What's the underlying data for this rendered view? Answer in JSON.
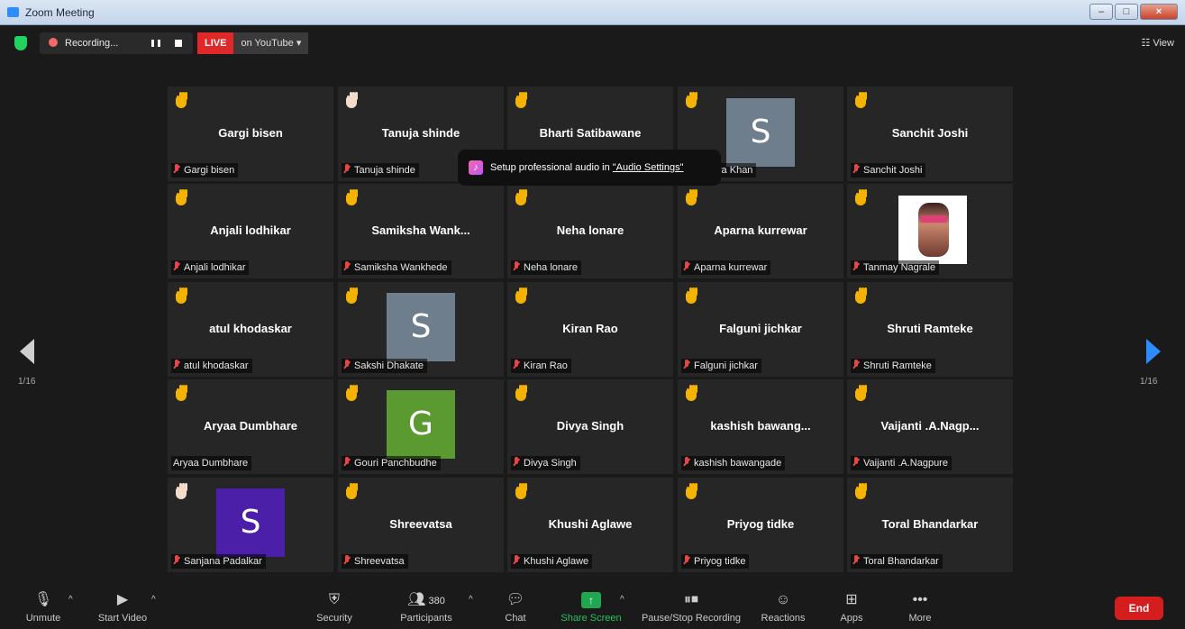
{
  "window": {
    "title": "Zoom Meeting",
    "controls": [
      "–",
      "□",
      "×"
    ]
  },
  "topbar": {
    "recording_label": "Recording...",
    "live_label": "LIVE",
    "youtube_label": "on YouTube ▾",
    "view_label": "☷ View"
  },
  "toast": {
    "text": "Setup professional audio in ",
    "link": "\"Audio Settings\"",
    "icon": "♪"
  },
  "pagination": {
    "left": "1/16",
    "right": "1/16"
  },
  "participants": [
    {
      "big": "Gargi bisen",
      "footer": "Gargi bisen",
      "hand": "yellow",
      "muted": true
    },
    {
      "big": "Tanuja shinde",
      "footer": "Tanuja shinde",
      "hand": "light",
      "muted": true
    },
    {
      "big": "Bharti Satibawane",
      "footer": "Bharti Satibawane",
      "hand": "yellow",
      "muted": true
    },
    {
      "big": "",
      "footer": "Somiya Khan",
      "hand": "yellow",
      "muted": true,
      "avatar": "S",
      "avatar_color": "#6e7e8c"
    },
    {
      "big": "Sanchit Joshi",
      "footer": "Sanchit Joshi",
      "hand": "yellow",
      "muted": true
    },
    {
      "big": "Anjali lodhikar",
      "footer": "Anjali lodhikar",
      "hand": "yellow",
      "muted": true
    },
    {
      "big": "Samiksha  Wank...",
      "footer": "Samiksha Wankhede",
      "hand": "yellow",
      "muted": true
    },
    {
      "big": "Neha lonare",
      "footer": "Neha lonare",
      "hand": "yellow",
      "muted": true
    },
    {
      "big": "Aparna kurrewar",
      "footer": "Aparna kurrewar",
      "hand": "yellow",
      "muted": true
    },
    {
      "big": "",
      "footer": "Tanmay Nagrale",
      "hand": "yellow",
      "muted": true,
      "photo": true
    },
    {
      "big": "atul khodaskar",
      "footer": "atul khodaskar",
      "hand": "yellow",
      "muted": true
    },
    {
      "big": "",
      "footer": "Sakshi Dhakate",
      "hand": "yellow",
      "muted": true,
      "avatar": "S",
      "avatar_color": "#6e7e8c"
    },
    {
      "big": "Kiran Rao",
      "footer": "Kiran Rao",
      "hand": "yellow",
      "muted": true
    },
    {
      "big": "Falguni jichkar",
      "footer": "Falguni jichkar",
      "hand": "yellow",
      "muted": true
    },
    {
      "big": "Shruti Ramteke",
      "footer": "Shruti Ramteke",
      "hand": "yellow",
      "muted": true
    },
    {
      "big": "Aryaa Dumbhare",
      "footer": "Aryaa Dumbhare",
      "hand": "yellow",
      "muted": false
    },
    {
      "big": "",
      "footer": "Gouri Panchbudhe",
      "hand": "yellow",
      "muted": true,
      "avatar": "G",
      "avatar_color": "#5a9a30"
    },
    {
      "big": "Divya Singh",
      "footer": "Divya Singh",
      "hand": "yellow",
      "muted": true
    },
    {
      "big": "kashish  bawang...",
      "footer": "kashish bawangade",
      "hand": "yellow",
      "muted": true
    },
    {
      "big": "Vaijanti  .A.Nagp...",
      "footer": "Vaijanti .A.Nagpure",
      "hand": "yellow",
      "muted": true
    },
    {
      "big": "",
      "footer": "Sanjana Padalkar",
      "hand": "light",
      "muted": true,
      "avatar": "S",
      "avatar_color": "#4b1fa8"
    },
    {
      "big": "Shreevatsa",
      "footer": "Shreevatsa",
      "hand": "yellow",
      "muted": true
    },
    {
      "big": "Khushi Aglawe",
      "footer": "Khushi Aglawe",
      "hand": "yellow",
      "muted": true
    },
    {
      "big": "Priyog tidke",
      "footer": "Priyog tidke",
      "hand": "yellow",
      "muted": true
    },
    {
      "big": "Toral Bhandarkar",
      "footer": "Toral Bhandarkar",
      "hand": "yellow",
      "muted": true
    }
  ],
  "toolbar": {
    "unmute": "Unmute",
    "start_video": "Start Video",
    "security": "Security",
    "participants": "Participants",
    "participants_count": "380",
    "chat": "Chat",
    "share_screen": "Share Screen",
    "pause_recording": "Pause/Stop Recording",
    "reactions": "Reactions",
    "apps": "Apps",
    "more": "More",
    "end": "End"
  }
}
